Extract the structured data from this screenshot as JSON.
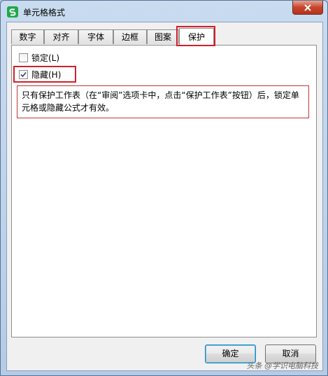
{
  "window": {
    "title": "单元格格式",
    "app_icon": "wps-spreadsheet-icon",
    "close_icon": "close-icon"
  },
  "tabs": [
    {
      "label": "数字"
    },
    {
      "label": "对齐"
    },
    {
      "label": "字体"
    },
    {
      "label": "边框"
    },
    {
      "label": "图案"
    },
    {
      "label": "保护",
      "active": true
    }
  ],
  "protection": {
    "locked": {
      "label": "锁定(L)",
      "checked": false
    },
    "hidden": {
      "label": "隐藏(H)",
      "checked": true
    },
    "note": "只有保护工作表（在“审阅”选项卡中，点击“保护工作表”按钮）后，锁定单元格或隐藏公式才有效。"
  },
  "buttons": {
    "ok": "确定",
    "cancel": "取消"
  },
  "watermark": "头条 @学识电脑科技",
  "colors": {
    "highlight": "#d0202c",
    "app_icon": "#1fa84a",
    "close": "#c7452d"
  }
}
